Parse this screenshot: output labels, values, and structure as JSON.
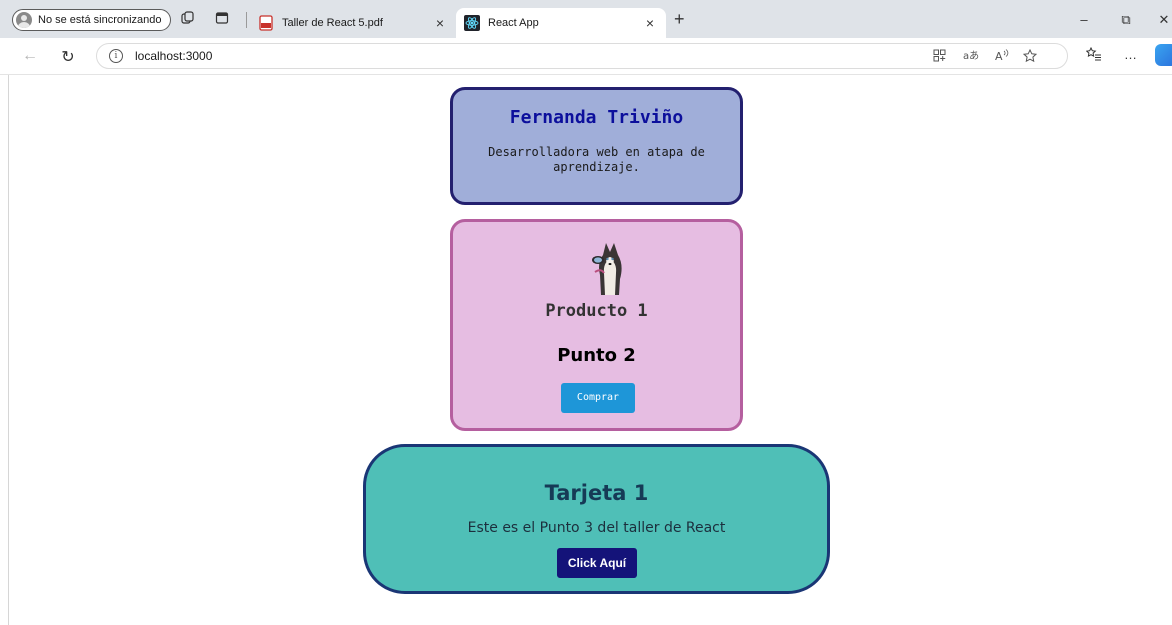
{
  "browser": {
    "profile_label": "No se está sincronizando",
    "tabs": [
      {
        "title": "Taller de React 5.pdf",
        "favicon": "pdf-icon",
        "active": false
      },
      {
        "title": "React App",
        "favicon": "react-icon",
        "active": true
      }
    ],
    "address": {
      "url": "localhost:3000"
    },
    "icons": {
      "back": "←",
      "refresh": "↻",
      "new_tab": "+",
      "close_tab": "×",
      "minimize": "–",
      "restore": "⧉",
      "close_window": "✕",
      "more": "…"
    }
  },
  "page": {
    "profile_card": {
      "name": "Fernanda Triviño",
      "description": "Desarrolladora web en atapa de aprendizaje."
    },
    "product_card": {
      "image": "husky-dog-image",
      "title": "Producto 1",
      "subtitle": "Punto 2",
      "button_label": "Comprar"
    },
    "tarjeta_card": {
      "title": "Tarjeta 1",
      "text": "Este es el Punto 3 del taller de React",
      "button_label": "Click Aquí"
    }
  },
  "colors": {
    "profile_bg": "#a0aed9",
    "profile_border": "#23206f",
    "product_bg": "#e6bde2",
    "product_border": "#b55f9f",
    "tarjeta_bg": "#4fbfb7",
    "tarjeta_border": "#1a3675",
    "comprar_button": "#1e96d8",
    "click_button": "#141379"
  }
}
